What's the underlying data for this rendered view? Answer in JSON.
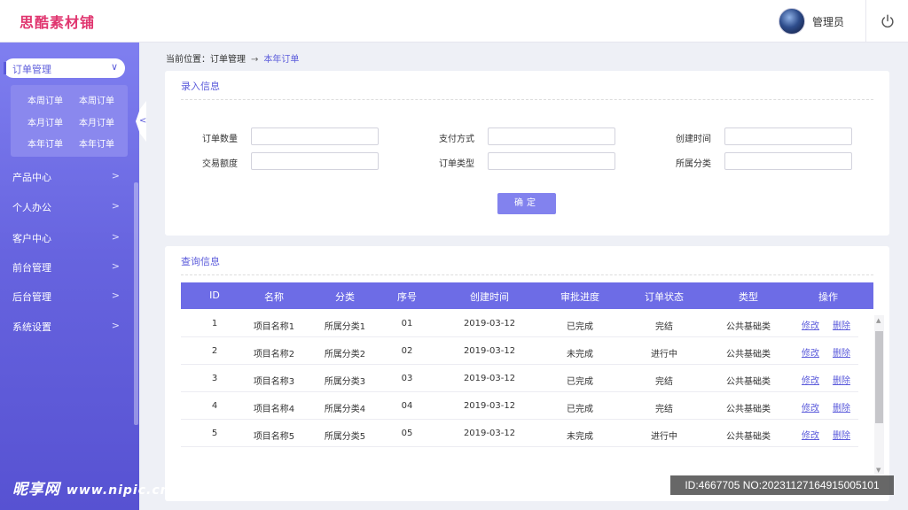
{
  "app": {
    "logo": "思酷素材铺",
    "user": "管理员"
  },
  "sidebar": {
    "active": "订单管理",
    "submenu": [
      "本周订单",
      "本周订单",
      "本月订单",
      "本月订单",
      "本年订单",
      "本年订单"
    ],
    "items": [
      "产品中心",
      "个人办公",
      "客户中心",
      "前台管理",
      "后台管理",
      "系统设置"
    ]
  },
  "breadcrumb": {
    "prefix": "当前位置：",
    "parent": "订单管理",
    "arrow": "→",
    "current": "本年订单"
  },
  "entry": {
    "title": "录入信息",
    "fields": [
      "订单数量",
      "支付方式",
      "创建时间",
      "交易额度",
      "订单类型",
      "所属分类"
    ],
    "confirm": "确定"
  },
  "query": {
    "title": "查询信息",
    "headers": [
      "ID",
      "名称",
      "分类",
      "序号",
      "创建时间",
      "审批进度",
      "订单状态",
      "类型",
      "操作"
    ],
    "rows": [
      [
        "1",
        "项目名称1",
        "所属分类1",
        "01",
        "2019-03-12",
        "已完成",
        "完结",
        "公共基础类"
      ],
      [
        "2",
        "项目名称2",
        "所属分类2",
        "02",
        "2019-03-12",
        "未完成",
        "进行中",
        "公共基础类"
      ],
      [
        "3",
        "项目名称3",
        "所属分类3",
        "03",
        "2019-03-12",
        "已完成",
        "完结",
        "公共基础类"
      ],
      [
        "4",
        "项目名称4",
        "所属分类4",
        "04",
        "2019-03-12",
        "已完成",
        "完结",
        "公共基础类"
      ],
      [
        "5",
        "项目名称5",
        "所属分类5",
        "05",
        "2019-03-12",
        "未完成",
        "进行中",
        "公共基础类"
      ]
    ],
    "edit": "修改",
    "delete": "删除"
  },
  "watermark": {
    "brand": "昵享网",
    "url": "www.nipic.cn"
  },
  "image_id": "ID:4667705 NO:20231127164915005101",
  "colors": {
    "accent": "#6d6ce6",
    "logo": "#e0356f",
    "sidebar_top": "#7f7ff0",
    "sidebar_bottom": "#5752d2"
  }
}
